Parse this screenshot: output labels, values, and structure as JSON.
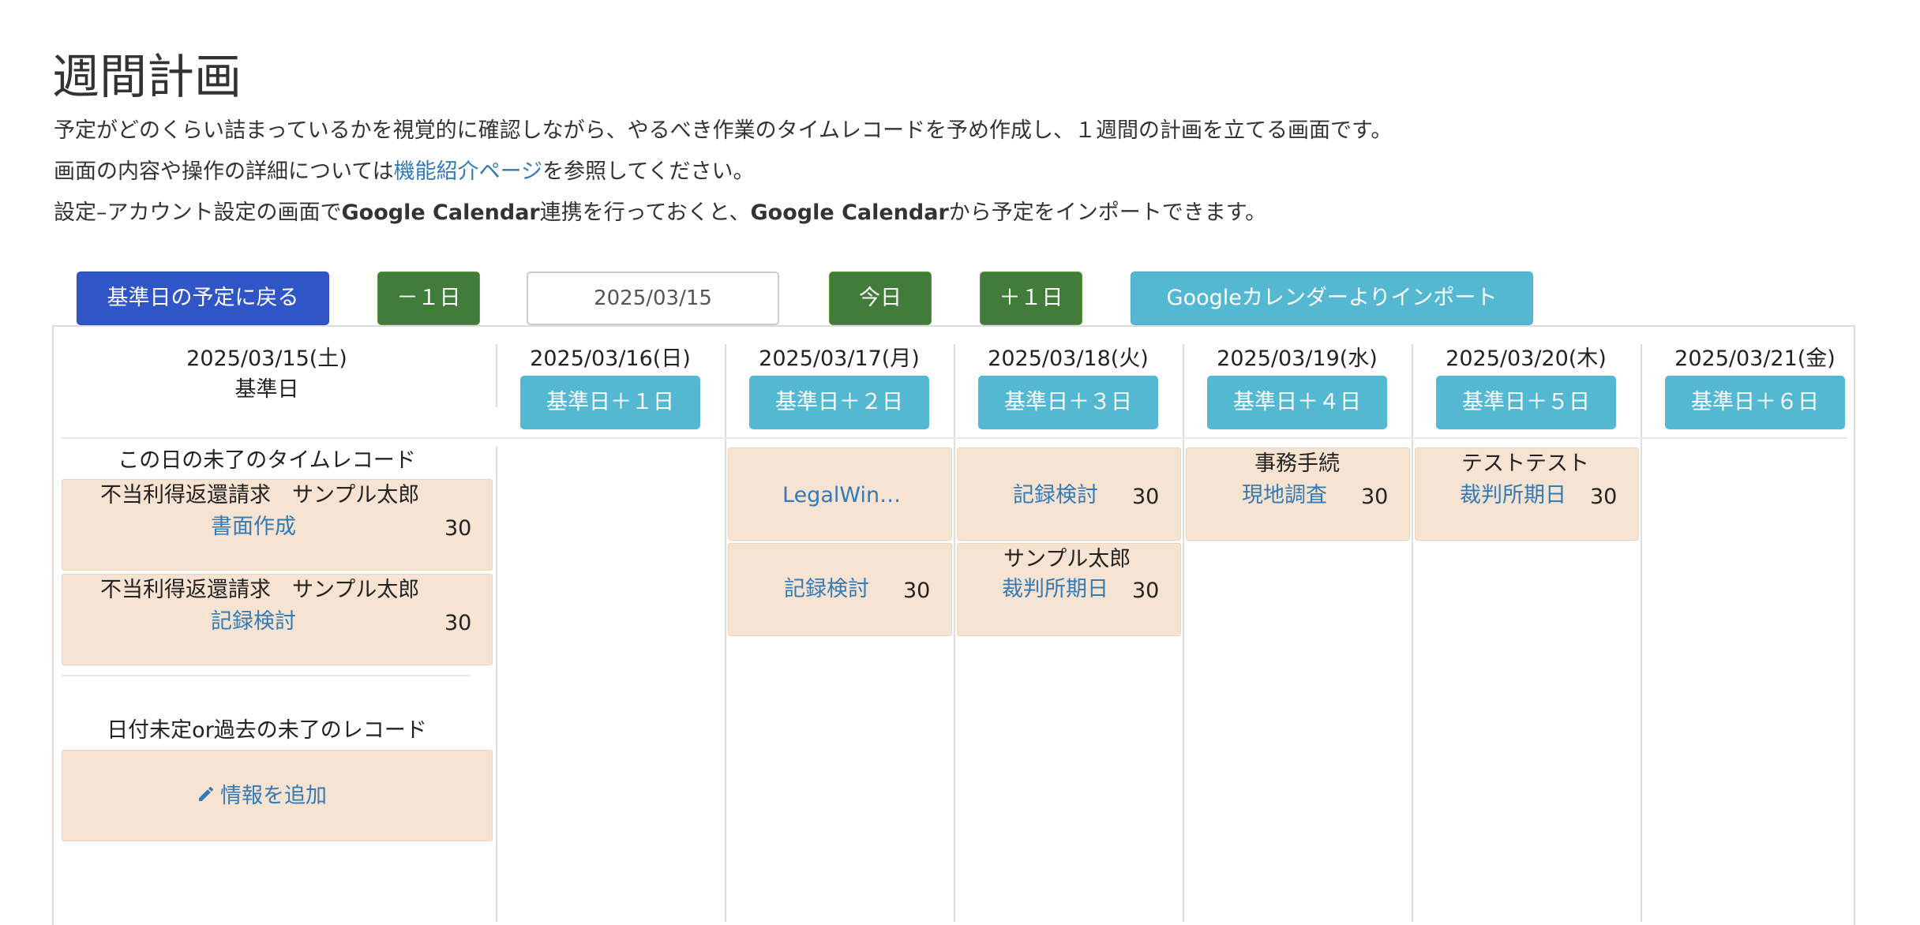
{
  "page": {
    "title": "週間計画",
    "desc1": "予定がどのくらい詰まっているかを視覚的に確認しながら、やるべき作業のタイムレコードを予め作成し、１週間の計画を立てる画面です。",
    "desc2_pre": "画面の内容や操作の詳細については",
    "desc2_link": "機能紹介ページ",
    "desc2_post": "を参照してください。",
    "desc3_a": "設定–アカウント設定の画面で",
    "desc3_b": "Google Calendar",
    "desc3_c": "連携を行っておくと、",
    "desc3_d": "Google Calendar",
    "desc3_e": "から予定をインポートできます。"
  },
  "toolbar": {
    "back_label": "基準日の予定に戻る",
    "minus_label": "－１日",
    "date_value": "2025/03/15",
    "today_label": "今日",
    "plus_label": "＋１日",
    "import_label": "Googleカレンダーよりインポート"
  },
  "base_column": {
    "date": "2025/03/15(土)",
    "label": "基準日",
    "incomplete_title": "この日の未了のタイムレコード",
    "records": [
      {
        "matter": "不当利得返還請求　サンプル太郎",
        "task": "書面作成",
        "minutes": "30"
      },
      {
        "matter": "不当利得返還請求　サンプル太郎",
        "task": "記録検討",
        "minutes": "30"
      }
    ],
    "undated_title": "日付未定or過去の未了のレコード",
    "add_label": "情報を追加"
  },
  "days": [
    {
      "date": "2025/03/16(日)",
      "button": "基準日＋１日"
    },
    {
      "date": "2025/03/17(月)",
      "button": "基準日＋２日"
    },
    {
      "date": "2025/03/18(火)",
      "button": "基準日＋３日"
    },
    {
      "date": "2025/03/19(水)",
      "button": "基準日＋４日"
    },
    {
      "date": "2025/03/20(木)",
      "button": "基準日＋５日"
    },
    {
      "date": "2025/03/21(金)",
      "button": "基準日＋６日"
    }
  ],
  "day_cards": {
    "d17_c1_task": "LegalWin…",
    "d17_c2_task": "記録検討",
    "d17_c2_min": "30",
    "d18_c1_task": "記録検討",
    "d18_c1_min": "30",
    "d18_c2_title": "サンプル太郎",
    "d18_c2_task": "裁判所期日",
    "d18_c2_min": "30",
    "d19_c1_title": "事務手続",
    "d19_c1_task": "現地調査",
    "d19_c1_min": "30",
    "d20_c1_title": "テストテスト",
    "d20_c1_task": "裁判所期日",
    "d20_c1_min": "30"
  },
  "colors": {
    "primary_blue": "#2f55c6",
    "green": "#427c3a",
    "cyan": "#54b8d3",
    "card": "#f6e3d2",
    "link": "#337ab7"
  }
}
